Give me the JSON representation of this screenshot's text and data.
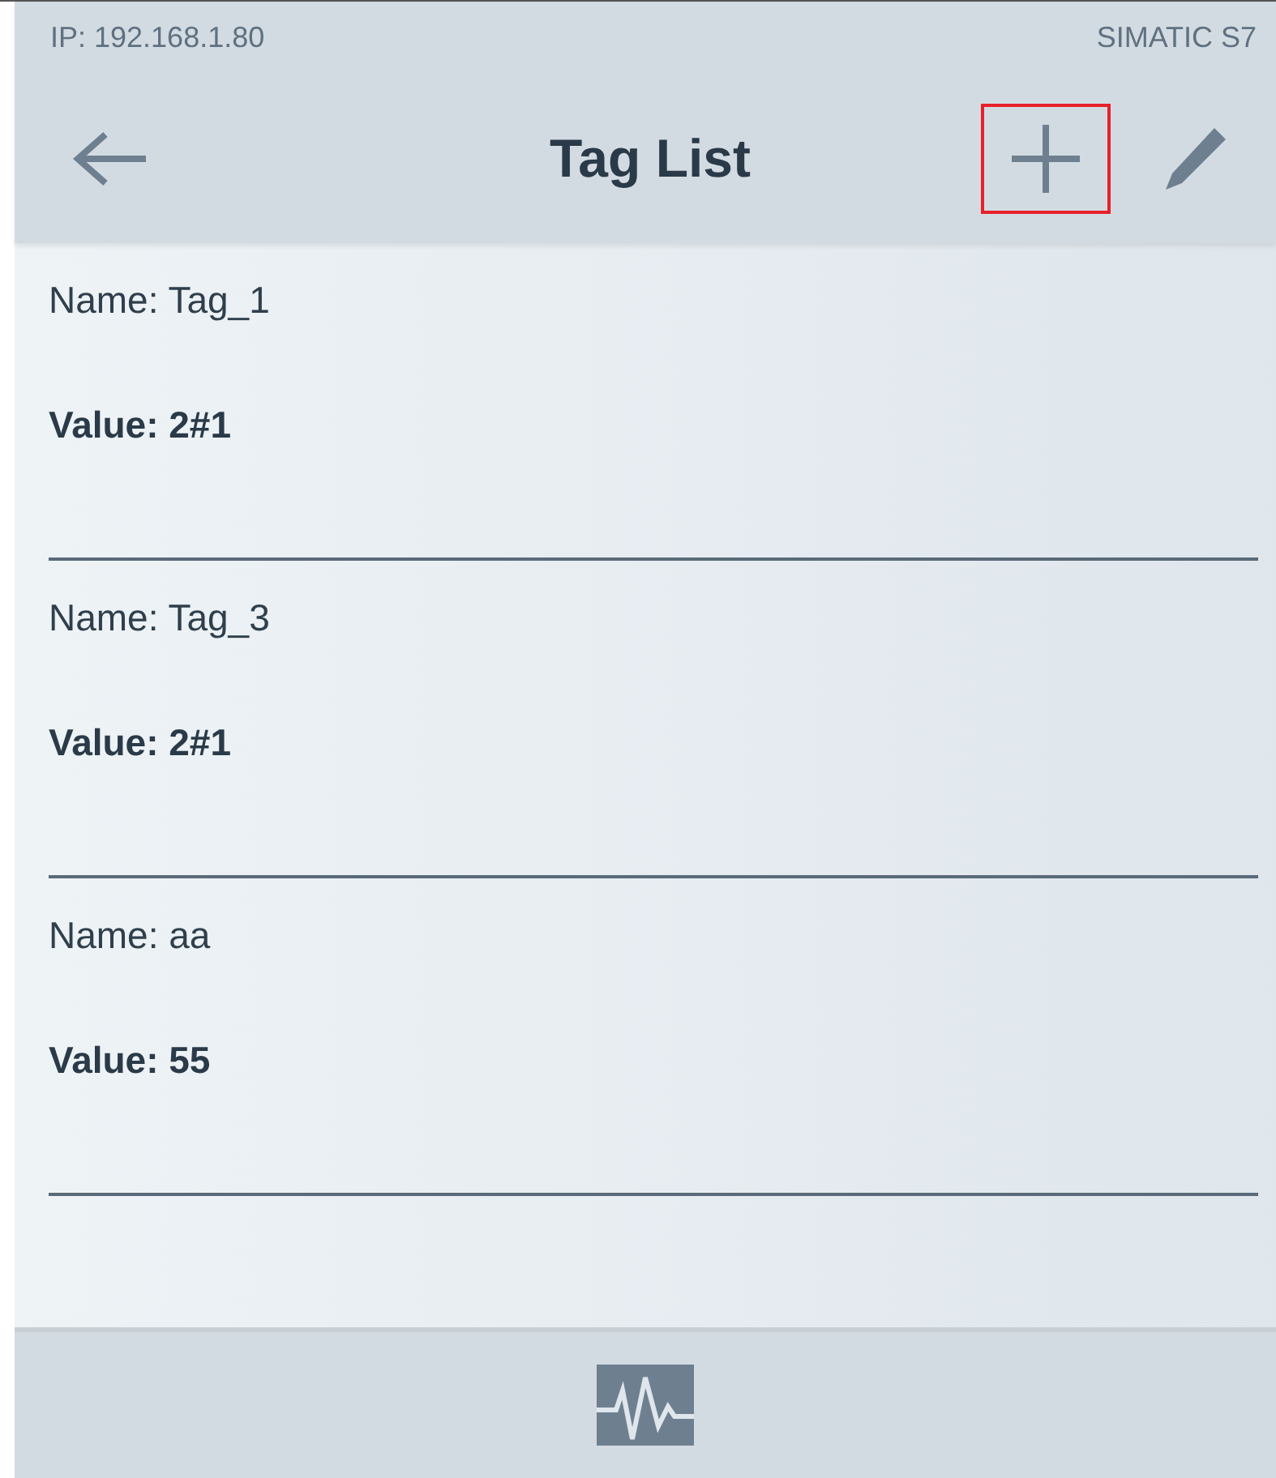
{
  "status_bar": {
    "ip": "IP: 192.168.1.80",
    "device": "SIMATIC S7"
  },
  "header": {
    "title": "Tag List",
    "add_highlighted": true
  },
  "tags": [
    {
      "name": "Name: Tag_1",
      "value": "Value: 2#1"
    },
    {
      "name": "Name: Tag_3",
      "value": "Value: 2#1"
    },
    {
      "name": "Name: aa",
      "value": "Value: 55"
    }
  ]
}
